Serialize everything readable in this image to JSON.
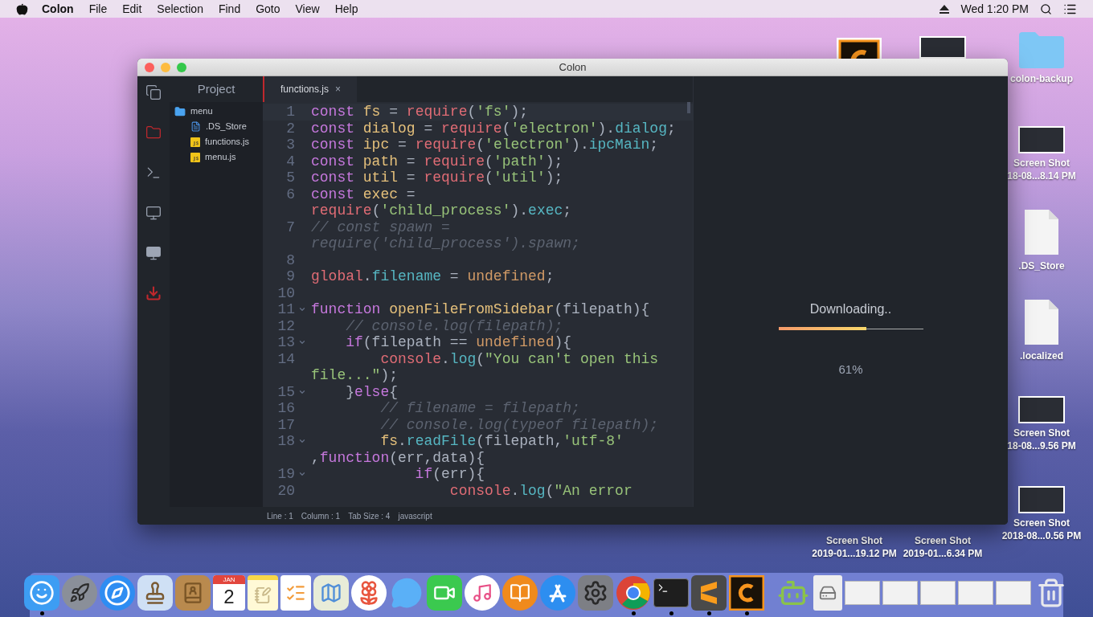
{
  "menu_bar": {
    "app_name": "Colon",
    "menus": [
      "File",
      "Edit",
      "Selection",
      "Find",
      "Goto",
      "View",
      "Help"
    ],
    "clock": "Wed 1:20 PM"
  },
  "window": {
    "title": "Colon",
    "activity_bar": [
      {
        "kind": "files",
        "highlighted": false
      },
      {
        "kind": "folder",
        "highlighted": true
      },
      {
        "kind": "terminal",
        "highlighted": false
      },
      {
        "kind": "monitor",
        "highlighted": false
      },
      {
        "kind": "display",
        "highlighted": false
      },
      {
        "kind": "download",
        "highlighted": true
      }
    ],
    "sidebar": {
      "title": "Project",
      "tree": [
        {
          "label": "menu",
          "kind": "folder",
          "children": [
            {
              "label": ".DS_Store",
              "kind": "doc"
            },
            {
              "label": "functions.js",
              "kind": "js"
            },
            {
              "label": "menu.js",
              "kind": "js"
            }
          ]
        }
      ]
    },
    "tabs": [
      {
        "label": "functions.js",
        "close": "×",
        "selected": true
      }
    ],
    "code": {
      "lines": [
        {
          "number": "1",
          "fold": false,
          "parts": [
            {
              "spans": [
                {
                  "kind": "kw",
                  "text": "const"
                },
                {
                  "kind": "var",
                  "text": " fs"
                },
                {
                  "kind": "plain",
                  "text": " = "
                },
                {
                  "kind": "builtin",
                  "text": "require"
                },
                {
                  "kind": "plain",
                  "text": "("
                },
                {
                  "kind": "str",
                  "text": "'fs'"
                },
                {
                  "kind": "plain",
                  "text": ");"
                }
              ]
            }
          ]
        },
        {
          "number": "2",
          "fold": false,
          "parts": [
            {
              "spans": [
                {
                  "kind": "kw",
                  "text": "const"
                },
                {
                  "kind": "var",
                  "text": " dialog"
                },
                {
                  "kind": "plain",
                  "text": " = "
                },
                {
                  "kind": "builtin",
                  "text": "require"
                },
                {
                  "kind": "plain",
                  "text": "("
                },
                {
                  "kind": "str",
                  "text": "'electron'"
                },
                {
                  "kind": "plain",
                  "text": ")."
                },
                {
                  "kind": "prop",
                  "text": "dialog"
                },
                {
                  "kind": "plain",
                  "text": ";"
                }
              ]
            }
          ]
        },
        {
          "number": "3",
          "fold": false,
          "parts": [
            {
              "spans": [
                {
                  "kind": "kw",
                  "text": "const"
                },
                {
                  "kind": "var",
                  "text": " ipc"
                },
                {
                  "kind": "plain",
                  "text": " = "
                },
                {
                  "kind": "builtin",
                  "text": "require"
                },
                {
                  "kind": "plain",
                  "text": "("
                },
                {
                  "kind": "str",
                  "text": "'electron'"
                },
                {
                  "kind": "plain",
                  "text": ")."
                },
                {
                  "kind": "prop",
                  "text": "ipcMain"
                },
                {
                  "kind": "plain",
                  "text": ";"
                }
              ]
            }
          ]
        },
        {
          "number": "4",
          "fold": false,
          "parts": [
            {
              "spans": [
                {
                  "kind": "kw",
                  "text": "const"
                },
                {
                  "kind": "var",
                  "text": " path"
                },
                {
                  "kind": "plain",
                  "text": " = "
                },
                {
                  "kind": "builtin",
                  "text": "require"
                },
                {
                  "kind": "plain",
                  "text": "("
                },
                {
                  "kind": "str",
                  "text": "'path'"
                },
                {
                  "kind": "plain",
                  "text": ");"
                }
              ]
            }
          ]
        },
        {
          "number": "5",
          "fold": false,
          "parts": [
            {
              "spans": [
                {
                  "kind": "kw",
                  "text": "const"
                },
                {
                  "kind": "var",
                  "text": " util"
                },
                {
                  "kind": "plain",
                  "text": " = "
                },
                {
                  "kind": "builtin",
                  "text": "require"
                },
                {
                  "kind": "plain",
                  "text": "("
                },
                {
                  "kind": "str",
                  "text": "'util'"
                },
                {
                  "kind": "plain",
                  "text": ");"
                }
              ]
            }
          ]
        },
        {
          "number": "6",
          "fold": false,
          "parts": [
            {
              "spans": [
                {
                  "kind": "kw",
                  "text": "const"
                },
                {
                  "kind": "var",
                  "text": " exec"
                },
                {
                  "kind": "plain",
                  "text": " ="
                }
              ]
            },
            {
              "spans": [
                {
                  "kind": "builtin",
                  "text": "require"
                },
                {
                  "kind": "plain",
                  "text": "("
                },
                {
                  "kind": "str",
                  "text": "'child_process'"
                },
                {
                  "kind": "plain",
                  "text": ")."
                },
                {
                  "kind": "prop",
                  "text": "exec"
                },
                {
                  "kind": "plain",
                  "text": ";"
                }
              ]
            }
          ]
        },
        {
          "number": "7",
          "fold": false,
          "parts": [
            {
              "spans": [
                {
                  "kind": "com",
                  "text": "// const spawn ="
                }
              ]
            },
            {
              "spans": [
                {
                  "kind": "com",
                  "text": "require('child_process').spawn;"
                }
              ]
            }
          ]
        },
        {
          "number": "8",
          "fold": false
        },
        {
          "number": "9",
          "fold": false,
          "parts": [
            {
              "spans": [
                {
                  "kind": "builtin",
                  "text": "global"
                },
                {
                  "kind": "plain",
                  "text": "."
                },
                {
                  "kind": "prop",
                  "text": "filename"
                },
                {
                  "kind": "plain",
                  "text": " = "
                },
                {
                  "kind": "const",
                  "text": "undefined"
                },
                {
                  "kind": "plain",
                  "text": ";"
                }
              ]
            }
          ]
        },
        {
          "number": "10",
          "fold": false
        },
        {
          "number": "11",
          "fold": true,
          "parts": [
            {
              "spans": [
                {
                  "kind": "kw",
                  "text": "function"
                },
                {
                  "kind": "var",
                  "text": " openFileFromSidebar"
                },
                {
                  "kind": "plain",
                  "text": "(filepath){"
                }
              ]
            }
          ]
        },
        {
          "number": "12",
          "fold": false,
          "parts": [
            {
              "spans": [
                {
                  "kind": "com",
                  "text": "    // console.log(filepath);"
                }
              ]
            }
          ]
        },
        {
          "number": "13",
          "fold": true,
          "parts": [
            {
              "spans": [
                {
                  "kind": "kw",
                  "text": "    if"
                },
                {
                  "kind": "plain",
                  "text": "(filepath == "
                },
                {
                  "kind": "const",
                  "text": "undefined"
                },
                {
                  "kind": "plain",
                  "text": "){"
                }
              ]
            }
          ]
        },
        {
          "number": "14",
          "fold": false,
          "parts": [
            {
              "spans": [
                {
                  "kind": "builtin",
                  "text": "        console"
                },
                {
                  "kind": "plain",
                  "text": "."
                },
                {
                  "kind": "prop",
                  "text": "log"
                },
                {
                  "kind": "plain",
                  "text": "("
                },
                {
                  "kind": "str",
                  "text": "\"You can't open this"
                }
              ]
            },
            {
              "spans": [
                {
                  "kind": "str",
                  "text": "file...\""
                },
                {
                  "kind": "plain",
                  "text": ");"
                }
              ]
            }
          ]
        },
        {
          "number": "15",
          "fold": true,
          "parts": [
            {
              "spans": [
                {
                  "kind": "plain",
                  "text": "    }"
                },
                {
                  "kind": "kw",
                  "text": "else"
                },
                {
                  "kind": "plain",
                  "text": "{"
                }
              ]
            }
          ]
        },
        {
          "number": "16",
          "fold": false,
          "parts": [
            {
              "spans": [
                {
                  "kind": "com",
                  "text": "        // filename = filepath;"
                }
              ]
            }
          ]
        },
        {
          "number": "17",
          "fold": false,
          "parts": [
            {
              "spans": [
                {
                  "kind": "com",
                  "text": "        // console.log(typeof filepath);"
                }
              ]
            }
          ]
        },
        {
          "number": "18",
          "fold": true,
          "parts": [
            {
              "spans": [
                {
                  "kind": "var",
                  "text": "        fs"
                },
                {
                  "kind": "plain",
                  "text": "."
                },
                {
                  "kind": "prop",
                  "text": "readFile"
                },
                {
                  "kind": "plain",
                  "text": "(filepath,"
                },
                {
                  "kind": "str",
                  "text": "'utf-8'"
                }
              ]
            },
            {
              "spans": [
                {
                  "kind": "plain",
                  "text": ","
                },
                {
                  "kind": "kw",
                  "text": "function"
                },
                {
                  "kind": "plain",
                  "text": "(err,data){"
                }
              ]
            }
          ]
        },
        {
          "number": "19",
          "fold": true,
          "parts": [
            {
              "spans": [
                {
                  "kind": "kw",
                  "text": "            if"
                },
                {
                  "kind": "plain",
                  "text": "(err){"
                }
              ]
            }
          ]
        },
        {
          "number": "20",
          "fold": false,
          "parts": [
            {
              "spans": [
                {
                  "kind": "builtin",
                  "text": "                console"
                },
                {
                  "kind": "plain",
                  "text": "."
                },
                {
                  "kind": "prop",
                  "text": "log"
                },
                {
                  "kind": "plain",
                  "text": "("
                },
                {
                  "kind": "str",
                  "text": "\"An error"
                }
              ]
            }
          ]
        }
      ]
    },
    "status_bar": [
      "Line : 1",
      "Column : 1",
      "Tab Size : 4",
      "javascript"
    ],
    "download": {
      "title": "Downloading..",
      "level": 0.61,
      "percent": "61%"
    }
  },
  "desktop_icons": [
    {
      "kind": "app"
    },
    {
      "kind": "shot"
    },
    {
      "kind": "folder",
      "lines": [
        "colon-backup"
      ]
    },
    {
      "kind": "shot",
      "lines": [
        "Screen Shot",
        "18-08...8.14 PM"
      ]
    },
    {
      "kind": "doc",
      "lines": [
        ".DS_Store"
      ]
    },
    {
      "kind": "doc",
      "lines": [
        ".localized"
      ]
    },
    {
      "kind": "shot",
      "lines": [
        "Screen Shot",
        "18-08...9.56 PM"
      ]
    },
    {
      "kind": "shot",
      "lines": [
        "Screen Shot",
        "2018-08...0.56 PM"
      ]
    },
    {
      "kind": "label",
      "lines": [
        "Screen Shot",
        "2019-01...19.12 PM"
      ]
    },
    {
      "kind": "label",
      "lines": [
        "Screen Shot",
        "2019-01...6.34 PM"
      ]
    }
  ],
  "dock": [
    {
      "kind": "finder",
      "running": true
    },
    {
      "kind": "launchpad",
      "running": false
    },
    {
      "kind": "safari",
      "running": false
    },
    {
      "kind": "mail",
      "running": false
    },
    {
      "kind": "contacts",
      "running": false
    },
    {
      "kind": "calendar",
      "running": false,
      "month": "JAN",
      "day": "2"
    },
    {
      "kind": "notes",
      "running": false
    },
    {
      "kind": "reminders",
      "running": false
    },
    {
      "kind": "maps",
      "running": false
    },
    {
      "kind": "photos",
      "running": false
    },
    {
      "kind": "messages",
      "running": false
    },
    {
      "kind": "facetime",
      "running": false
    },
    {
      "kind": "music",
      "running": false
    },
    {
      "kind": "books",
      "running": false
    },
    {
      "kind": "appstore",
      "running": false
    },
    {
      "kind": "settings",
      "running": false
    },
    {
      "kind": "chrome",
      "running": true
    },
    {
      "kind": "terminal",
      "running": true
    },
    {
      "kind": "sublime",
      "running": true
    },
    {
      "kind": "colon",
      "running": true
    },
    {
      "kind": "separator"
    },
    {
      "kind": "android",
      "running": false
    },
    {
      "kind": "disk",
      "running": false
    },
    {
      "kind": "thumb",
      "running": false
    },
    {
      "kind": "thumb",
      "running": false
    },
    {
      "kind": "thumb",
      "running": false
    },
    {
      "kind": "thumb",
      "running": false
    },
    {
      "kind": "thumb",
      "running": false
    },
    {
      "kind": "trash",
      "running": false
    }
  ]
}
